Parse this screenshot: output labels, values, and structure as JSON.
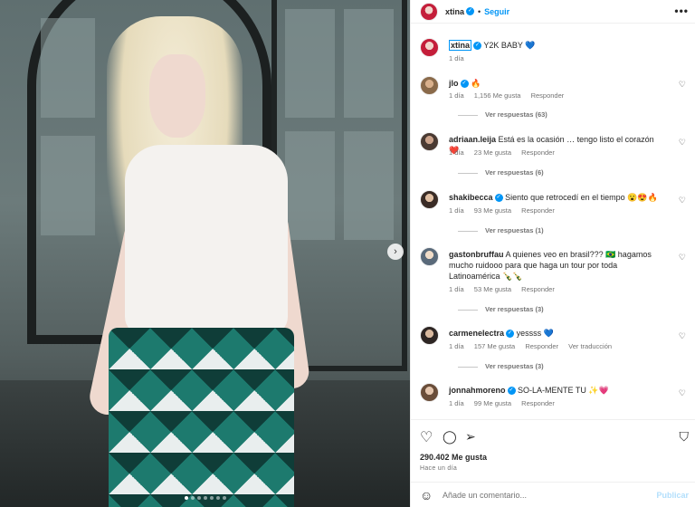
{
  "post": {
    "username": "xtina",
    "follow_label": "Seguir",
    "separator": "•",
    "more_label": "•••",
    "caption": "Y2K BABY 💙",
    "caption_time": "1 día",
    "carousel_next": "›",
    "carousel_dots": 7,
    "carousel_active_index": 0
  },
  "comments": [
    {
      "user": "jlo",
      "verified": true,
      "text": "🔥",
      "time": "1 día",
      "likes": "1,156 Me gusta",
      "reply": "Responder",
      "replies": "Ver respuestas (63)"
    },
    {
      "user": "adriaan.leija",
      "verified": false,
      "text": "Está es la ocasión … tengo listo el corazón ❤️",
      "time": "1 día",
      "likes": "23 Me gusta",
      "reply": "Responder",
      "replies": "Ver respuestas (6)"
    },
    {
      "user": "shakibecca",
      "verified": true,
      "text": "Siento que retrocedí en el tiempo 😮😍🔥",
      "time": "1 día",
      "likes": "93 Me gusta",
      "reply": "Responder",
      "replies": "Ver respuestas (1)"
    },
    {
      "user": "gastonbruffau",
      "verified": false,
      "text": "A quienes veo en brasil??? 🇧🇷 hagamos mucho ruidooo para que haga un tour por toda Latinoamérica 🍾🍾",
      "time": "1 día",
      "likes": "53 Me gusta",
      "reply": "Responder",
      "replies": "Ver respuestas (3)"
    },
    {
      "user": "carmenelectra",
      "verified": true,
      "text": "yessss 💙",
      "time": "1 día",
      "likes": "157 Me gusta",
      "reply": "Responder",
      "translate": "Ver traducción",
      "replies": "Ver respuestas (3)"
    },
    {
      "user": "jonnahmoreno",
      "verified": true,
      "text": "SO-LA-MENTE TU ✨💗",
      "time": "1 día",
      "likes": "99 Me gusta",
      "reply": "Responder"
    }
  ],
  "actions": {
    "like_icon": "heart-outline",
    "comment_icon": "speech-bubble",
    "share_icon": "paper-plane",
    "save_icon": "bookmark",
    "like_glyph": "♡",
    "comment_glyph": "◯",
    "share_glyph": "➢",
    "save_glyph": "⛉",
    "likes_count": "290.402 Me gusta",
    "posted_ago": "Hace un día"
  },
  "composer": {
    "emoji_glyph": "☺",
    "placeholder": "Añade un comentario...",
    "publish_label": "Publicar"
  },
  "colors": {
    "accent": "#0095f6",
    "muted": "#737373",
    "publish_disabled": "#b2dffc"
  },
  "heart_glyph": "♡"
}
